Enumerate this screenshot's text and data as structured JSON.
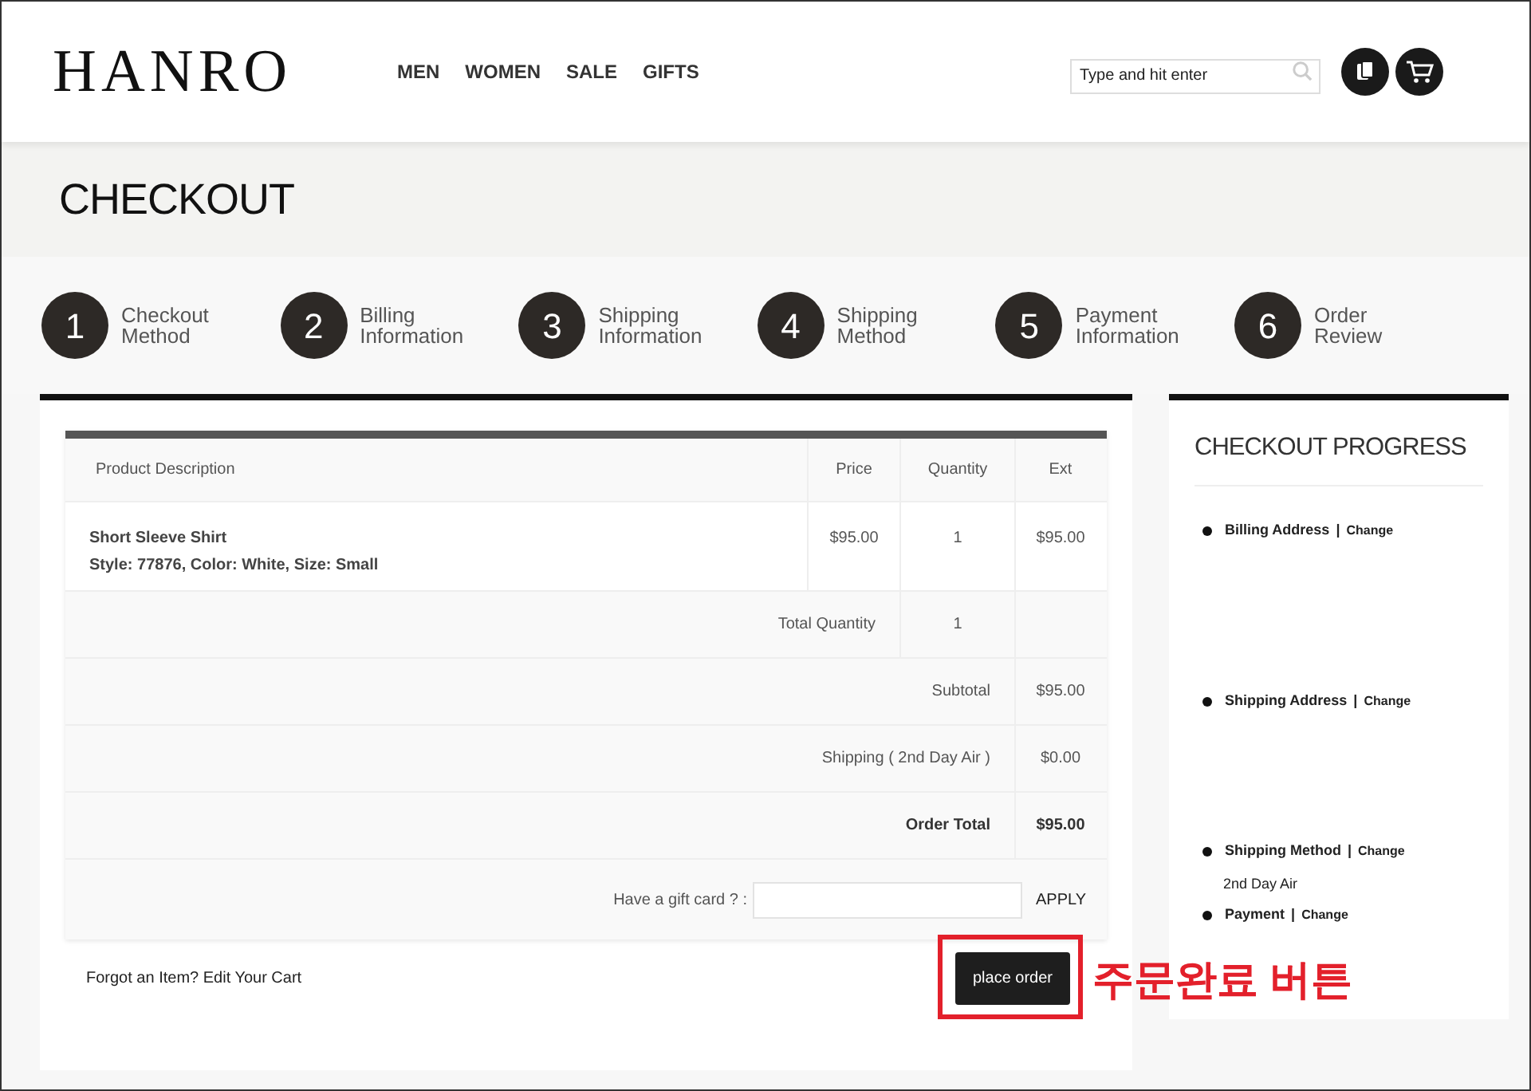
{
  "header": {
    "logo": "HANRO",
    "nav": [
      "MEN",
      "WOMEN",
      "SALE",
      "GIFTS"
    ],
    "search": {
      "placeholder": "Type and hit enter"
    }
  },
  "page_title": "CHECKOUT",
  "steps": [
    {
      "number": "1",
      "lines": [
        "Checkout",
        "Method"
      ]
    },
    {
      "number": "2",
      "lines": [
        "Billing",
        "Information"
      ]
    },
    {
      "number": "3",
      "lines": [
        "Shipping",
        "Information"
      ]
    },
    {
      "number": "4",
      "lines": [
        "Shipping",
        "Method"
      ]
    },
    {
      "number": "5",
      "lines": [
        "Payment",
        "Information"
      ]
    },
    {
      "number": "6",
      "lines": [
        "Order",
        "Review"
      ]
    }
  ],
  "cart": {
    "columns": [
      "Product Description",
      "Price",
      "Quantity",
      "Ext"
    ],
    "items": [
      {
        "name": "Short Sleeve Shirt",
        "details": "Style: 77876, Color: White, Size: Small",
        "price": "$95.00",
        "quantity": "1",
        "ext": "$95.00"
      }
    ],
    "summary": [
      {
        "kind": "quantity",
        "label": "Total Quantity",
        "value": "1",
        "emphasis": false
      },
      {
        "kind": "amount",
        "label": "Subtotal",
        "value": "$95.00",
        "emphasis": false
      },
      {
        "kind": "amount",
        "label": "Shipping ( 2nd Day Air )",
        "value": "$0.00",
        "emphasis": false
      },
      {
        "kind": "amount",
        "label": "Order Total",
        "value": "$95.00",
        "emphasis": true
      }
    ],
    "gift_card": {
      "label": "Have a gift card ? :",
      "button": "APPLY"
    }
  },
  "forgot_link": "Forgot an Item? Edit Your Cart",
  "place_order": "place order",
  "progress": {
    "title": "CHECKOUT PROGRESS",
    "sections": [
      {
        "label": "Billing Address",
        "separator": "|",
        "change": "Change"
      },
      {
        "label": "Shipping Address",
        "separator": "|",
        "change": "Change"
      },
      {
        "label": "Shipping Method",
        "separator": "|",
        "change": "Change",
        "detail": "2nd Day Air"
      },
      {
        "label": "Payment",
        "separator": "|",
        "change": "Change"
      }
    ]
  },
  "annotation": {
    "text": "주문완료 버튼"
  }
}
